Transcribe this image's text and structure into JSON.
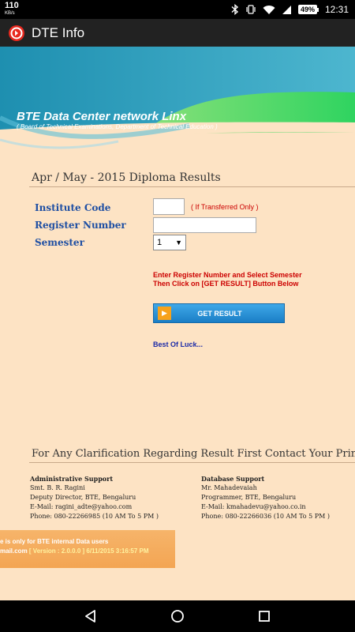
{
  "status_bar": {
    "net_speed": "110",
    "net_unit": "KB/s",
    "battery": "49%",
    "time": "12:31"
  },
  "app_bar": {
    "title": "DTE Info"
  },
  "banner": {
    "title": "BTE Data Center network Linx",
    "subtitle": "( Board of Technical Examinations, Department of Technical Education )"
  },
  "form": {
    "section_title": "Apr / May - 2015 Diploma Results",
    "institute_code_label": "Institute Code",
    "institute_code_value": "",
    "transfer_hint": "( If Transferred Only )",
    "register_number_label": "Register Number",
    "register_number_value": "",
    "semester_label": "Semester",
    "semester_selected": "1",
    "instruction_line1": "Enter Register Number and Select Semester",
    "instruction_line2": "Then Click on [GET RESULT] Button Below",
    "get_result_label": "GET RESULT",
    "best_of_luck": "Best Of Luck..."
  },
  "clarification": {
    "heading": "For Any Clarification Regarding Result First Contact Your Principal"
  },
  "contacts": {
    "admin": {
      "heading": "Administrative Support",
      "name": "Smt. B. R. Ragini",
      "role": "Deputy Director, BTE, Bengaluru",
      "email": "E-Mail: ragini_adte@yahoo.com",
      "phone": "Phone: 080-22266985 (10 AM To 5 PM )"
    },
    "database": {
      "heading": "Database Support",
      "name": "Mr. Mahadevaiah",
      "role": "Programmer, BTE, Bengaluru",
      "email": "E-Mail: kmahadevu@yahoo.co.in",
      "phone": "Phone: 080-22266036 (10 AM To 5 PM )"
    }
  },
  "footer": {
    "line1": "e is only for BTE internal Data users",
    "line2_prefix": "mail.com ",
    "line2_version": "[ Version : 2.0.0.0 ] 6/11/2015 3:16:57 PM"
  },
  "colors": {
    "page_bg": "#fde3c4",
    "label_blue": "#1f4fa3",
    "alert_red": "#cc0000",
    "button_blue": "#1a7ec6",
    "banner_teal": "#2a9bb5",
    "banner_green": "#3ddc6a"
  }
}
